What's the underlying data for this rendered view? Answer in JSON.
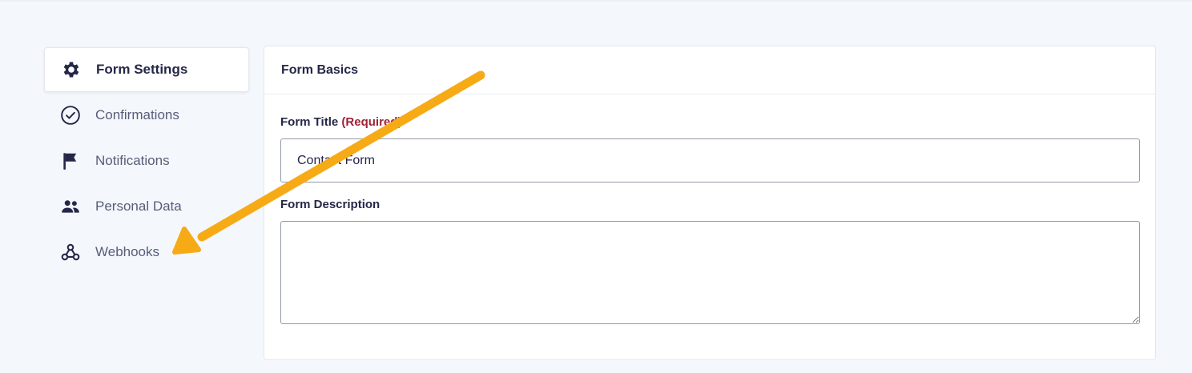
{
  "sidebar": {
    "items": [
      {
        "label": "Form Settings",
        "icon": "gear-icon",
        "active": true
      },
      {
        "label": "Confirmations",
        "icon": "check-circle-icon",
        "active": false
      },
      {
        "label": "Notifications",
        "icon": "flag-icon",
        "active": false
      },
      {
        "label": "Personal Data",
        "icon": "users-icon",
        "active": false
      },
      {
        "label": "Webhooks",
        "icon": "webhook-icon",
        "active": false
      }
    ]
  },
  "panel": {
    "title": "Form Basics",
    "form_title_label": "Form Title",
    "required_text": "(Required)",
    "form_title_value": "Contact Form",
    "form_description_label": "Form Description",
    "form_description_value": ""
  },
  "annotation": {
    "arrow_color": "#f6ab16"
  },
  "colors": {
    "background": "#f4f7fb",
    "required": "#9d2235",
    "text_dark": "#242748"
  }
}
